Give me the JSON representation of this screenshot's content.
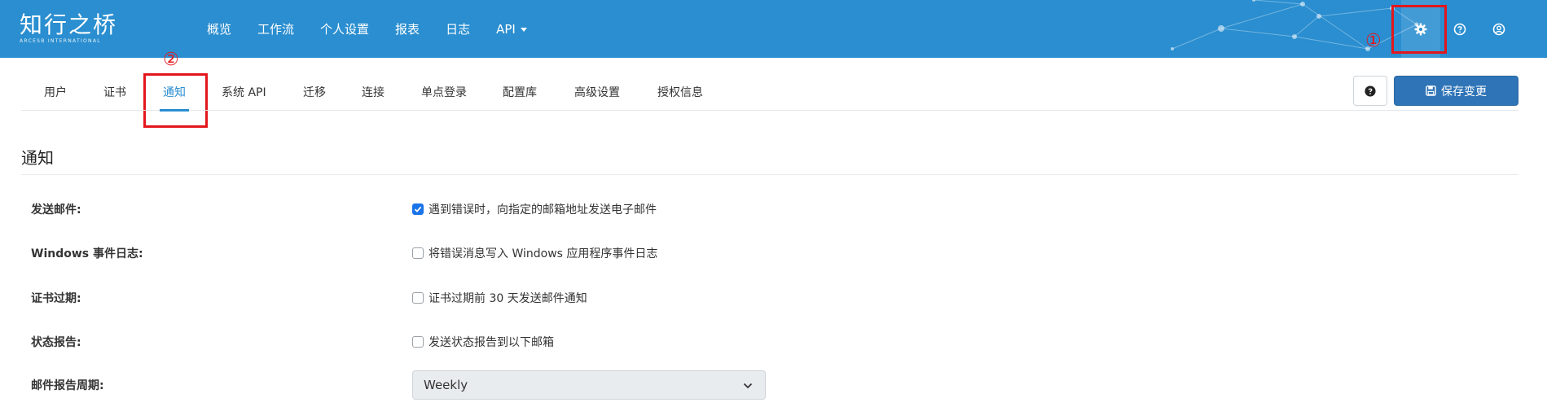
{
  "brand": {
    "logo_text": "知行之桥",
    "logo_sub": "ARCESB INTERNATIONAL"
  },
  "nav": {
    "items": [
      "概览",
      "工作流",
      "个人设置",
      "报表",
      "日志"
    ],
    "api_label": "API"
  },
  "right_icons": [
    "gear-icon",
    "question-circle-icon",
    "user-circle-icon"
  ],
  "annotations": {
    "marker_1": "①",
    "marker_2": "②"
  },
  "tabs": {
    "items": [
      "用户",
      "证书",
      "通知",
      "系统 API",
      "迁移",
      "连接",
      "单点登录",
      "配置库",
      "高级设置",
      "授权信息"
    ],
    "active": "通知"
  },
  "toolbar": {
    "save_label": "保存变更"
  },
  "section": {
    "title": "通知",
    "rows": [
      {
        "label": "发送邮件:",
        "option": "遇到错误时，向指定的邮箱地址发送电子邮件",
        "checked": true
      },
      {
        "label": "Windows 事件日志:",
        "option": "将错误消息写入 Windows 应用程序事件日志",
        "checked": false
      },
      {
        "label": "证书过期:",
        "option": "证书过期前 30 天发送邮件通知",
        "checked": false
      },
      {
        "label": "状态报告:",
        "option": "发送状态报告到以下邮箱",
        "checked": false
      }
    ],
    "period_label": "邮件报告周期:",
    "period_value": "Weekly"
  },
  "colors": {
    "navbar": "#2a8ed0",
    "accent": "#2a8ed0",
    "save_button": "#2f74b6",
    "annotation": "#e3161c"
  }
}
